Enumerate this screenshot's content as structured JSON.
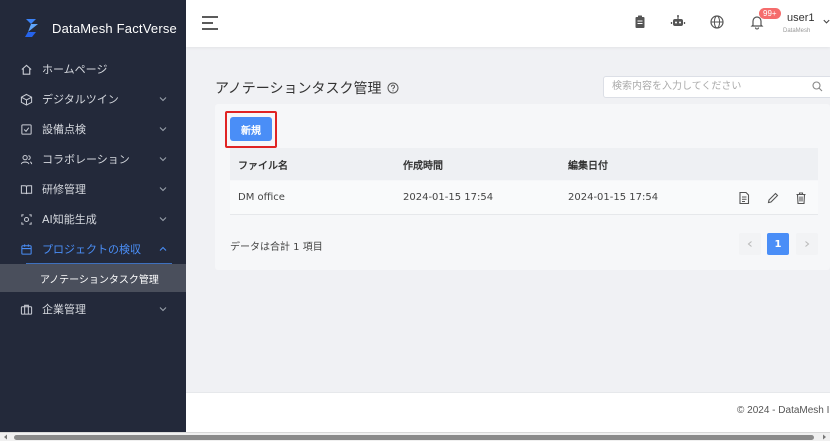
{
  "brand": {
    "name": "DataMesh FactVerse"
  },
  "sidebar": {
    "items": [
      {
        "label": "ホームページ",
        "icon": "home-icon",
        "has_chevron": false
      },
      {
        "label": "デジタルツイン",
        "icon": "cube-icon",
        "has_chevron": true
      },
      {
        "label": "設備点検",
        "icon": "checkbox-icon",
        "has_chevron": true
      },
      {
        "label": "コラボレーション",
        "icon": "users-icon",
        "has_chevron": true
      },
      {
        "label": "研修管理",
        "icon": "book-icon",
        "has_chevron": true
      },
      {
        "label": "AI知能生成",
        "icon": "ai-icon",
        "has_chevron": true
      },
      {
        "label": "プロジェクトの検収",
        "icon": "calendar-icon",
        "has_chevron": true,
        "active": true
      },
      {
        "label": "企業管理",
        "icon": "briefcase-icon",
        "has_chevron": true
      }
    ],
    "sub_item": "アノテーションタスク管理"
  },
  "header": {
    "badge": "99+",
    "user_name": "user1",
    "user_org": "DataMesh"
  },
  "main": {
    "title": "アノテーションタスク管理",
    "search_placeholder": "検索内容を入力してください",
    "new_button": "新規",
    "columns": [
      "ファイル名",
      "作成時間",
      "編集日付"
    ],
    "rows": [
      {
        "name": "DM office",
        "created": "2024-01-15 17:54",
        "edited": "2024-01-15 17:54"
      }
    ],
    "summary": "データは合計 1 項目",
    "current_page": "1"
  },
  "footer": {
    "copyright": "© 2024 - DataMesh I"
  },
  "colors": {
    "accent": "#4a8ef7",
    "sidebar_bg": "#23293a",
    "highlight": "#e02424"
  }
}
